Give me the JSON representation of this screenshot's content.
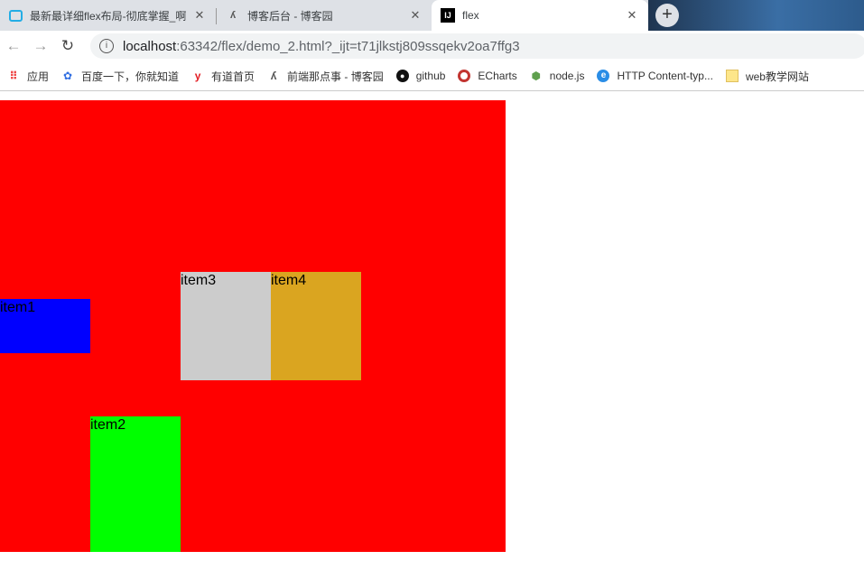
{
  "tabs": [
    {
      "title": "最新最详细flex布局-彻底掌握_啊",
      "icon": "bilibili-icon"
    },
    {
      "title": "博客后台 - 博客园",
      "icon": "cnblogs-icon"
    },
    {
      "title": "flex",
      "icon": "intellij-icon",
      "active": true
    }
  ],
  "address": {
    "host": "localhost",
    "rest": ":63342/flex/demo_2.html?_ijt=t71jlkstj809ssqekv2oa7ffg3"
  },
  "bookmarks": [
    {
      "label": "应用",
      "icon": "apps-grid-icon"
    },
    {
      "label": "百度一下，你就知道",
      "icon": "baidu-icon"
    },
    {
      "label": "有道首页",
      "icon": "youdao-icon"
    },
    {
      "label": "前端那点事 - 博客园",
      "icon": "cnblogs-icon"
    },
    {
      "label": "github",
      "icon": "github-icon"
    },
    {
      "label": "ECharts",
      "icon": "echarts-icon"
    },
    {
      "label": "node.js",
      "icon": "nodejs-icon"
    },
    {
      "label": "HTTP Content-typ...",
      "icon": "edge-icon"
    },
    {
      "label": "web教学网站",
      "icon": "folder-icon"
    }
  ],
  "content": {
    "container_color": "#ff0000",
    "items": [
      {
        "label": "item1",
        "color": "#0000ff"
      },
      {
        "label": "item2",
        "color": "#00ff00"
      },
      {
        "label": "item3",
        "color": "#cccccc"
      },
      {
        "label": "item4",
        "color": "#daa520"
      }
    ]
  }
}
